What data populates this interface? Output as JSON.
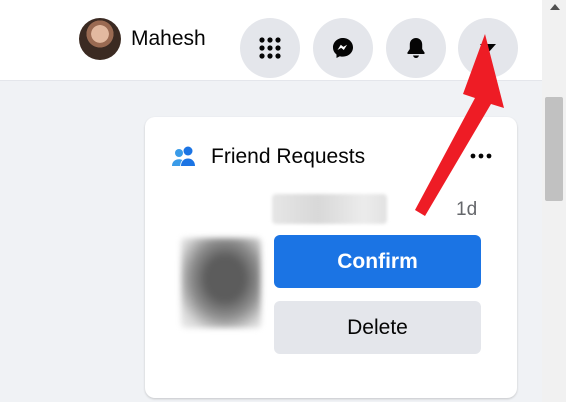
{
  "topbar": {
    "profile_name": "Mahesh",
    "icons": {
      "menu": "grid-dots-icon",
      "messenger": "messenger-icon",
      "notifications": "bell-icon",
      "account": "caret-down-icon"
    }
  },
  "friend_requests": {
    "title": "Friend Requests",
    "header_icon": "people-icon",
    "more_icon": "more-dots-icon",
    "request": {
      "age": "1d",
      "confirm_label": "Confirm",
      "delete_label": "Delete"
    }
  },
  "colors": {
    "confirm_bg": "#1b74e4",
    "button_gray": "#e4e6eb",
    "annotation_arrow": "#ee1c25",
    "people_icon": "#1b74e4"
  }
}
